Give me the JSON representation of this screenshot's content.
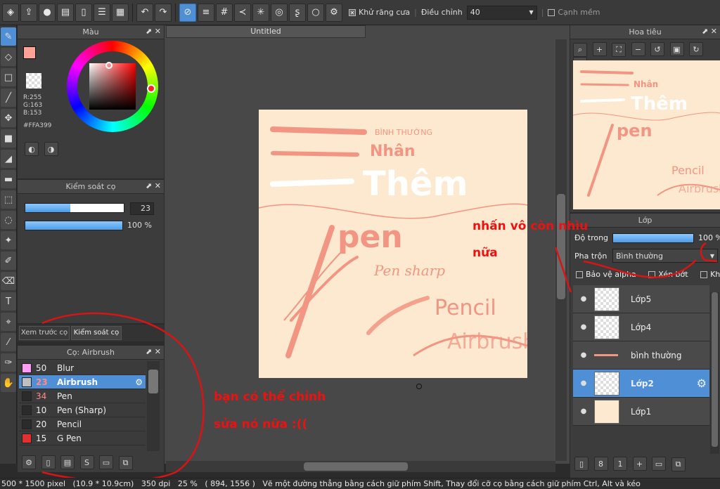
{
  "toolbar": {
    "antialias_label": "Khử răng cưa",
    "adjust_label": "Điều chỉnh",
    "adjust_value": "40",
    "smooth_edge_label": "Cạnh mềm"
  },
  "color_panel": {
    "title": "Màu",
    "r": "R:255",
    "g": "G:163",
    "b": "B:153",
    "hex": "#FFA399",
    "main_color": "#FFA399"
  },
  "brush_control": {
    "title": "Kiểm soát cọ",
    "size_value": "23",
    "opacity_value": "100 %"
  },
  "brush_panel": {
    "tab_preview": "Xem trước cọ",
    "tab_control": "Kiểm soát cọ",
    "title": "Cọ: Airbrush",
    "brushes": [
      {
        "size": "50",
        "name": "Blur",
        "color": "#ff9cf5"
      },
      {
        "size": "23",
        "name": "Airbrush",
        "color": "#bfbfbf"
      },
      {
        "size": "34",
        "name": "Pen",
        "color": "#2b2b2b"
      },
      {
        "size": "10",
        "name": "Pen (Sharp)",
        "color": "#2b2b2b"
      },
      {
        "size": "20",
        "name": "Pencil",
        "color": "#2b2b2b"
      },
      {
        "size": "15",
        "name": "G Pen",
        "color": "#e03030"
      }
    ]
  },
  "document": {
    "tab_title": "Untitled",
    "paper_color": "#fde9cf",
    "art_texts": {
      "binh_thuong": "BÌNH THƯỜNG",
      "nhan": "Nhân",
      "them": "Thêm",
      "pen": "pen",
      "pen_sharp": "Pen sharp",
      "pencil": "Pencil",
      "airbrush": "Airbrush"
    }
  },
  "navigator": {
    "title": "Hoa tiêu"
  },
  "layers_panel": {
    "title": "Lớp",
    "opacity_label": "Độ trong",
    "opacity_value": "100 %",
    "blend_label": "Pha trộn",
    "blend_value": "Bình thường",
    "protect_alpha": "Bảo vệ alpha",
    "clipping": "Xén bớt",
    "lock": "Khóa",
    "layers": [
      {
        "name": "Lớp5"
      },
      {
        "name": "Lớp4"
      },
      {
        "name": "bình thường"
      },
      {
        "name": "Lớp2"
      },
      {
        "name": "Lớp1"
      }
    ]
  },
  "annotations": {
    "right_line1": "nhấn vô còn nhìu",
    "right_line2": "nữa",
    "bottom_line1": "bạn có thể chỉnh",
    "bottom_line2": "sửa nó nữa :(("
  },
  "statusbar": {
    "size": "500 * 1500 pixel",
    "cm": "(10.9 * 10.9cm)",
    "dpi": "350 dpi",
    "zoom": "25 %",
    "coords": "( 894, 1556 )",
    "hint": "Vẽ một đường thẳng bằng cách giữ phím Shift, Thay đổi cỡ cọ bằng cách giữ phím Ctrl, Alt và kéo"
  }
}
